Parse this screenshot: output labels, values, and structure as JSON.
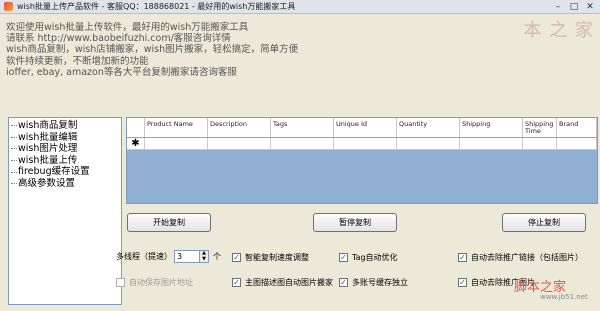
{
  "window": {
    "title": "wish批量上传产品软件 - 客服QQ：188868021 - 最好用的wish万能搬家工具",
    "buttons": {
      "minimize": "–",
      "maximize": "□",
      "close": "✕"
    }
  },
  "notice": {
    "lines": [
      "欢迎使用wish批量上传软件，最好用的wish万能搬家工具",
      "请联系 http://www.baobeifuzhi.com/客服咨询详情",
      "wish商品复制，wish店铺搬家，wish图片搬家，轻松搞定，简单方便",
      "软件持续更新，不断增加新的功能",
      "ioffer, ebay, amazon等各大平台复制搬家请咨询客服"
    ]
  },
  "watermark": {
    "top": "本 之 家",
    "bottom": "脚本之家",
    "url": "www.jb51.net"
  },
  "tree": {
    "items": [
      "wish商品复制",
      "wish批量编辑",
      "wish图片处理",
      "wish批量上传",
      "firebug缓存设置",
      "高级参数设置"
    ]
  },
  "grid": {
    "columns": [
      "Product Name",
      "Description",
      "Tags",
      "Unique Id",
      "Quantity",
      "Shipping",
      "Shipping Time",
      "Brand"
    ],
    "new_row_marker": "✱"
  },
  "buttons": {
    "start": "开始复制",
    "pause": "暂停复制",
    "stop": "停止复制"
  },
  "options": {
    "threads_label": "多线程（提速）",
    "threads_value": "3",
    "threads_unit": "个",
    "smart_speed": "智能复制速度调整",
    "tag_optimize": "Tag自动优化",
    "remove_promo_links": "自动去除推广链接（包括图片）",
    "auto_save_images": "自动保存图片地址",
    "main_image_filter": "主图描述图自动图片搬家",
    "multi_account_cache": "多账号缓存独立",
    "remove_promo_images": "自动去除推广图片"
  }
}
